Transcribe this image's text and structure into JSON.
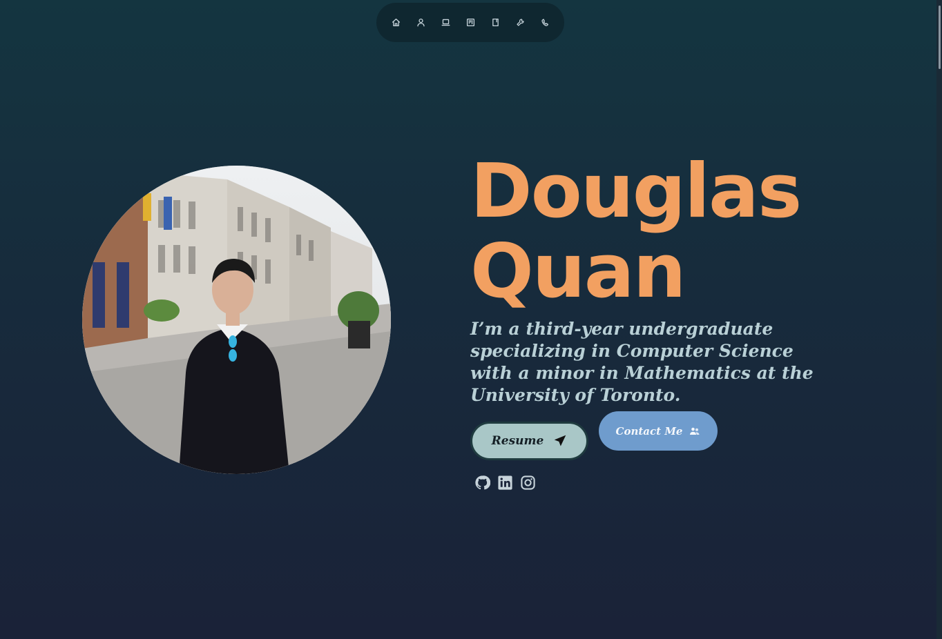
{
  "nav": {
    "items": [
      {
        "icon": "home-icon"
      },
      {
        "icon": "user-icon"
      },
      {
        "icon": "laptop-icon"
      },
      {
        "icon": "board-icon"
      },
      {
        "icon": "book-icon"
      },
      {
        "icon": "wrench-icon"
      },
      {
        "icon": "phone-icon"
      }
    ]
  },
  "hero": {
    "name_first": "Douglas",
    "name_last": "Quan",
    "bio": "I’m a third-year undergraduate specializing in Computer Science with a minor in Mathematics at the University of Toronto.",
    "resume_label": "Resume",
    "contact_label": "Contact Me"
  },
  "socials": [
    {
      "icon": "github-icon"
    },
    {
      "icon": "linkedin-icon"
    },
    {
      "icon": "instagram-icon"
    }
  ],
  "colors": {
    "accent_orange": "#f2a061",
    "bio_text": "#b9d0d6",
    "resume_bg": "#a9c7c7",
    "contact_bg": "#6f9ccd"
  }
}
